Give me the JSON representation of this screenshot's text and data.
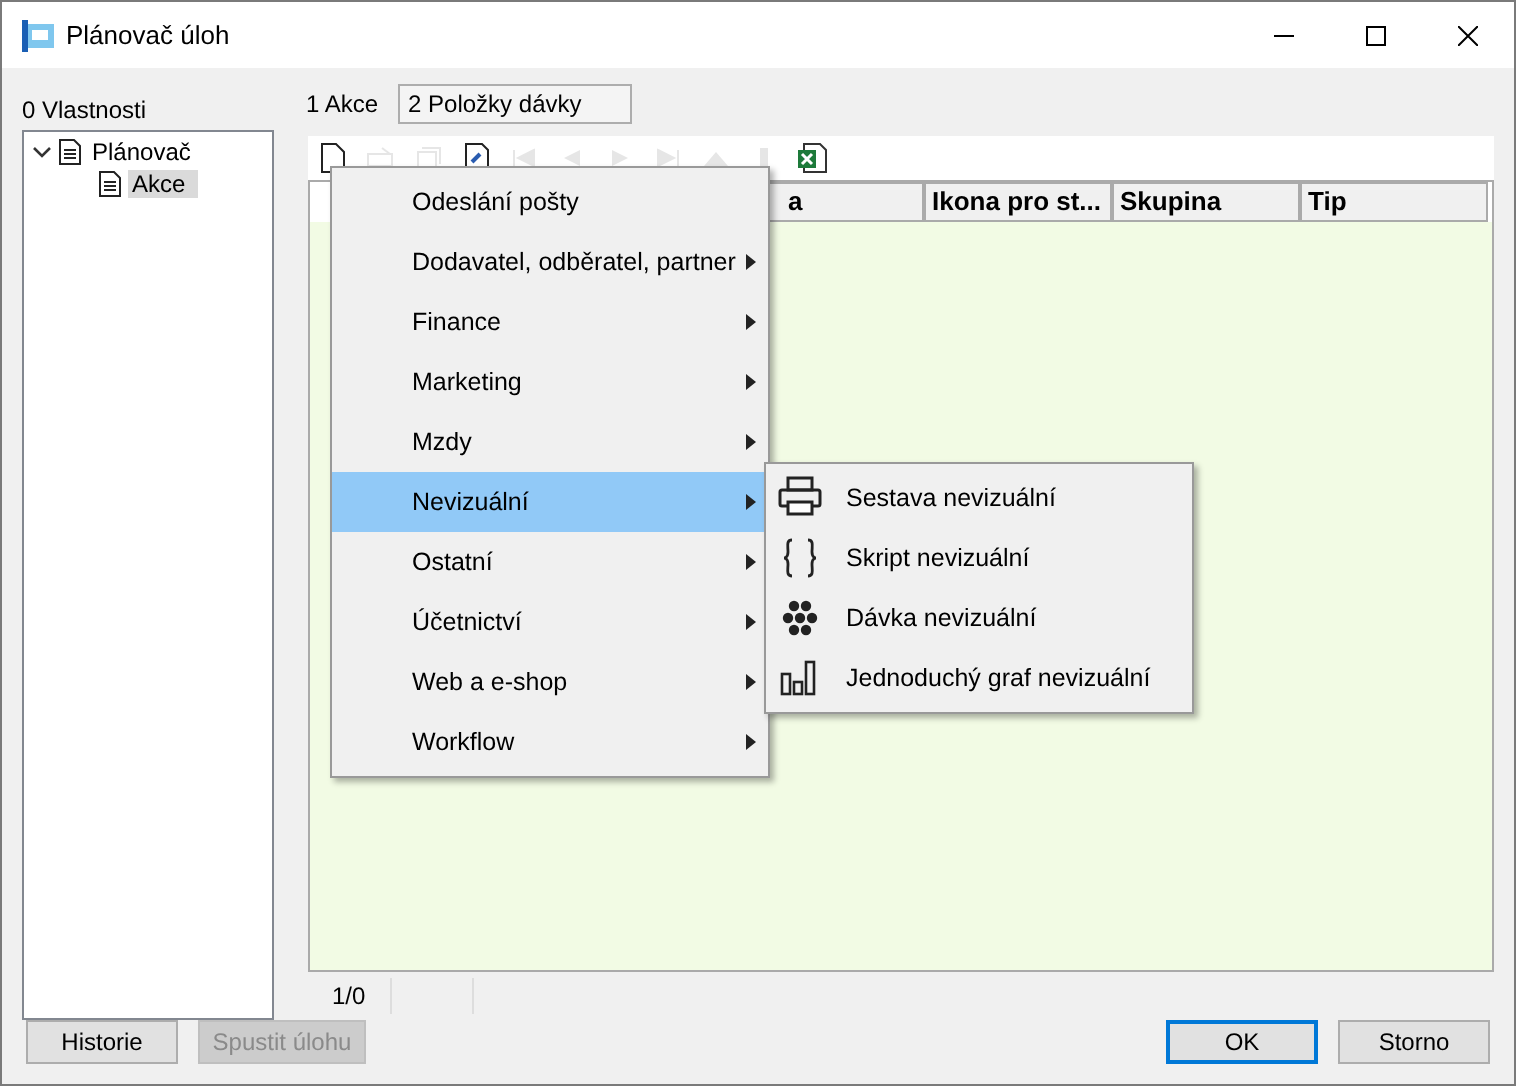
{
  "window": {
    "title": "Plánovač úloh"
  },
  "properties_label": "0 Vlastnosti",
  "tree": [
    {
      "label": "Plánovač",
      "expanded": true,
      "selected": false,
      "children": [
        {
          "label": "Akce",
          "selected": true
        }
      ]
    }
  ],
  "tabs": [
    {
      "label": "1 Akce",
      "selected": false
    },
    {
      "label": "2 Položky dávky",
      "selected": true
    }
  ],
  "toolbar": [
    {
      "kind": "new",
      "disabled": false
    },
    {
      "kind": "edit",
      "disabled": true
    },
    {
      "kind": "copy",
      "disabled": true
    },
    {
      "kind": "doc",
      "disabled": false
    },
    {
      "kind": "first",
      "disabled": true
    },
    {
      "kind": "prev",
      "disabled": true
    },
    {
      "kind": "next",
      "disabled": true
    },
    {
      "kind": "last",
      "disabled": true
    },
    {
      "kind": "up",
      "disabled": true
    },
    {
      "kind": "down",
      "disabled": true
    },
    {
      "kind": "excel",
      "disabled": false
    }
  ],
  "table": {
    "columns": [
      "a",
      "Ikona pro st...",
      "Skupina",
      "Tip"
    ]
  },
  "status_bar": {
    "position": "1/0"
  },
  "context_menu": [
    {
      "label": "Odeslání pošty",
      "submenu": false,
      "selected": false
    },
    {
      "label": "Dodavatel, odběratel, partner",
      "submenu": true,
      "selected": false
    },
    {
      "label": "Finance",
      "submenu": true,
      "selected": false
    },
    {
      "label": "Marketing",
      "submenu": true,
      "selected": false
    },
    {
      "label": "Mzdy",
      "submenu": true,
      "selected": false
    },
    {
      "label": "Nevizuální",
      "submenu": true,
      "selected": true
    },
    {
      "label": "Ostatní",
      "submenu": true,
      "selected": false
    },
    {
      "label": "Účetnictví",
      "submenu": true,
      "selected": false
    },
    {
      "label": "Web a e-shop",
      "submenu": true,
      "selected": false
    },
    {
      "label": "Workflow",
      "submenu": true,
      "selected": false
    }
  ],
  "submenu": [
    {
      "label": "Sestava nevizuální",
      "kind": "report"
    },
    {
      "label": "Skript nevizuální",
      "kind": "script"
    },
    {
      "label": "Dávka nevizuální",
      "kind": "batch"
    },
    {
      "label": "Jednoduchý graf nevizuální",
      "kind": "chart"
    }
  ],
  "buttons": [
    {
      "label": "Historie",
      "disabled": false,
      "default": false
    },
    {
      "label": "Spustit úlohu",
      "disabled": true,
      "default": false
    },
    {
      "label": "OK",
      "disabled": false,
      "default": true
    },
    {
      "label": "Storno",
      "disabled": false,
      "default": false
    }
  ]
}
